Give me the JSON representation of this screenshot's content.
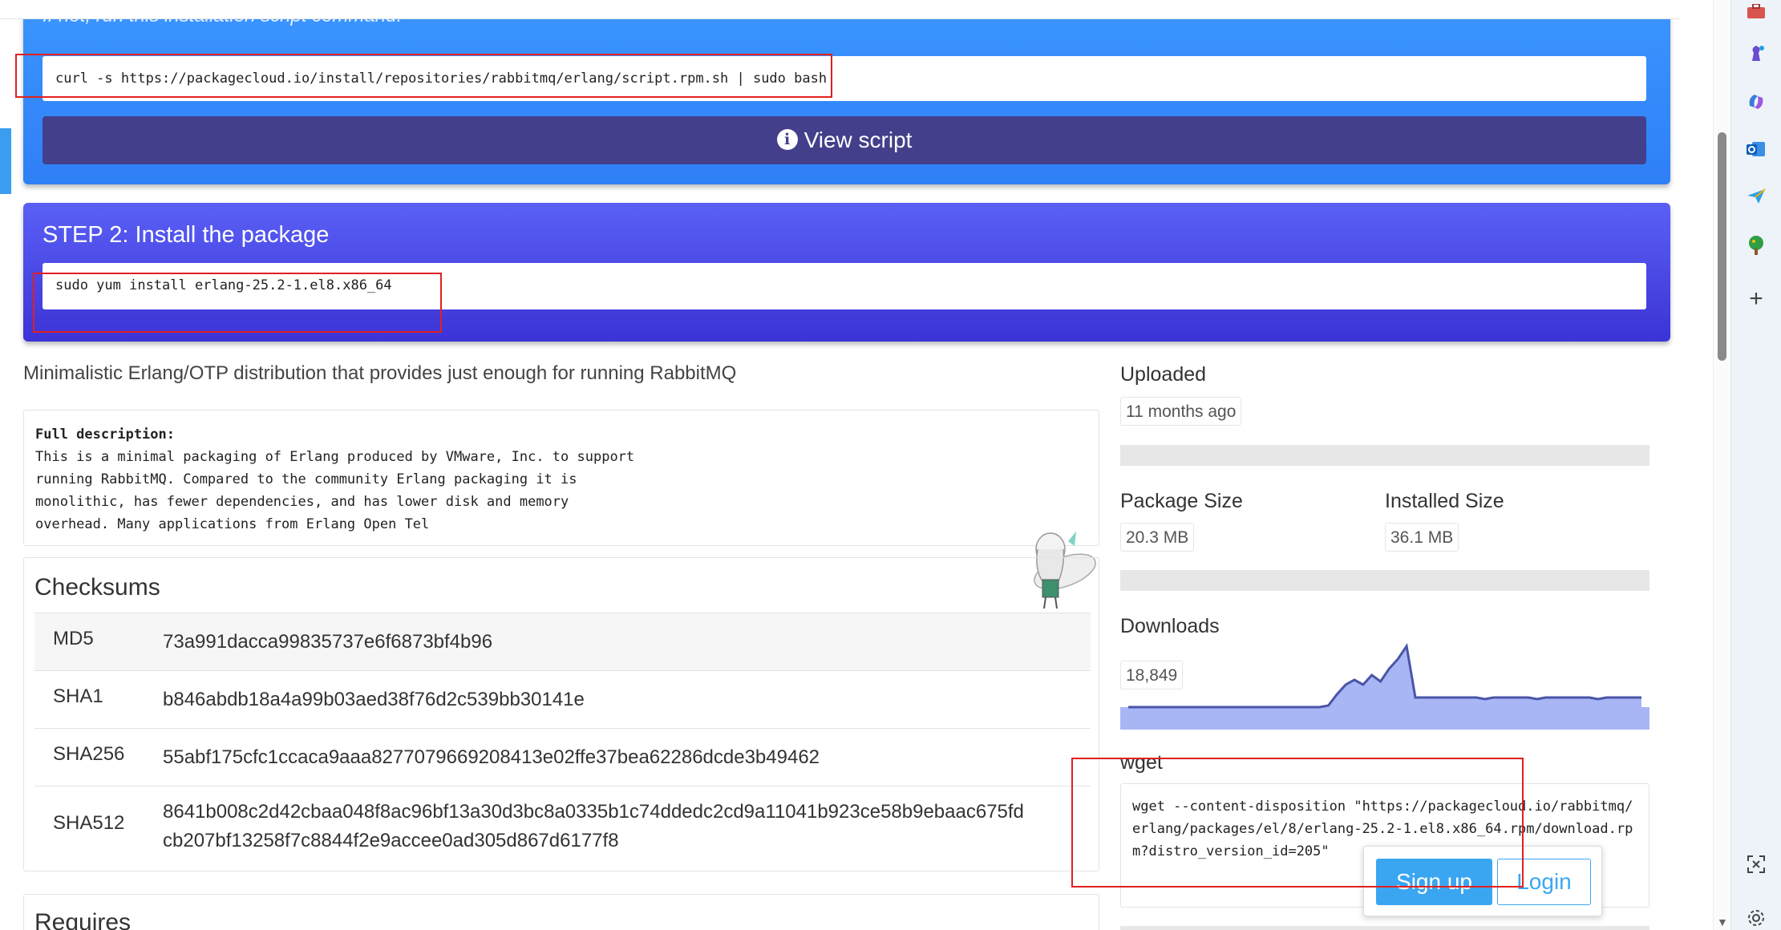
{
  "step1": {
    "hint": "If not, run this installation script command:",
    "command": "curl -s https://packagecloud.io/install/repositories/rabbitmq/erlang/script.rpm.sh | sudo bash",
    "view_script_label": "View script",
    "color": "#3c97ff"
  },
  "step2": {
    "title": "STEP 2: Install the package",
    "command": "sudo yum install erlang-25.2-1.el8.x86_64",
    "color": "#4a4ae8"
  },
  "description": "Minimalistic Erlang/OTP distribution that provides just enough for running RabbitMQ",
  "full_description": {
    "label": "Full description:",
    "text": "This is a minimal packaging of Erlang produced by VMware, Inc. to support\nrunning RabbitMQ. Compared to the community Erlang packaging it is\nmonolithic, has fewer dependencies, and has lower disk and memory\noverhead. Many applications from Erlang Open Tel"
  },
  "checksums": {
    "title": "Checksums",
    "rows": [
      {
        "algo": "MD5",
        "value": "73a991dacca99835737e6f6873bf4b96"
      },
      {
        "algo": "SHA1",
        "value": "b846abdb18a4a99b03aed38f76d2c539bb30141e"
      },
      {
        "algo": "SHA256",
        "value": "55abf175cfc1ccaca9aaa8277079669208413e02ffe37bea62286dcde3b49462"
      },
      {
        "algo": "SHA512",
        "value": "8641b008c2d42cbaa048f8ac96bf13a30d3bc8a0335b1c74ddedc2cd9a11041b923ce58b9ebaac675fd",
        "value2": "cb207bf13258f7c8844f2e9accee0ad305d867d6177f8"
      }
    ]
  },
  "requires": {
    "title": "Requires"
  },
  "meta": {
    "uploaded_label": "Uploaded",
    "uploaded_value": "11 months ago",
    "package_size_label": "Package Size",
    "package_size_value": "20.3 MB",
    "installed_size_label": "Installed Size",
    "installed_size_value": "36.1 MB",
    "downloads_label": "Downloads",
    "downloads_value": "18,849"
  },
  "chart_data": {
    "type": "area",
    "x": [
      0,
      1,
      2,
      3,
      4,
      5,
      6,
      7,
      8,
      9,
      10,
      11,
      12,
      13,
      14,
      15,
      16,
      17,
      18,
      19,
      20,
      21,
      22,
      23,
      24,
      25,
      26,
      27,
      28,
      29,
      30,
      31,
      32,
      33,
      34,
      35,
      36,
      37,
      38,
      39,
      40,
      41,
      42,
      43,
      44,
      45,
      46,
      47,
      48,
      49,
      50,
      51,
      52,
      53,
      54,
      55,
      56,
      57,
      58,
      59
    ],
    "values": [
      0,
      0,
      0,
      0,
      0,
      0,
      0,
      0,
      0,
      0,
      0,
      0,
      0,
      0,
      0,
      0,
      0,
      0,
      0,
      0,
      0,
      0,
      0,
      1,
      8,
      14,
      17,
      14,
      20,
      16,
      24,
      30,
      38,
      6,
      6,
      6,
      6,
      6,
      6,
      6,
      6,
      5,
      6,
      6,
      6,
      6,
      6,
      5,
      6,
      6,
      6,
      6,
      6,
      6,
      5,
      6,
      6,
      6,
      6,
      6
    ],
    "ylim": [
      0,
      40
    ],
    "line_color": "#4a55a8",
    "fill_color": "#a9b6f5",
    "grid": false
  },
  "wget": {
    "label": "wget",
    "command": "wget --content-disposition \"https://packagecloud.io/rabbitmq/erlang/packages/el/8/erlang-25.2-1.el8.x86_64.rpm/download.rpm?distro_version_id=205\""
  },
  "auth": {
    "signup_label": "Sign up",
    "login_label": "Login",
    "accent": "#3aa6f2"
  },
  "sidebar": {
    "icons": [
      "toolbox-icon",
      "chess-piece-icon",
      "copilot-icon",
      "outlook-icon",
      "send-icon",
      "tree-icon",
      "add-icon",
      "screenshot-icon",
      "settings-icon"
    ]
  }
}
